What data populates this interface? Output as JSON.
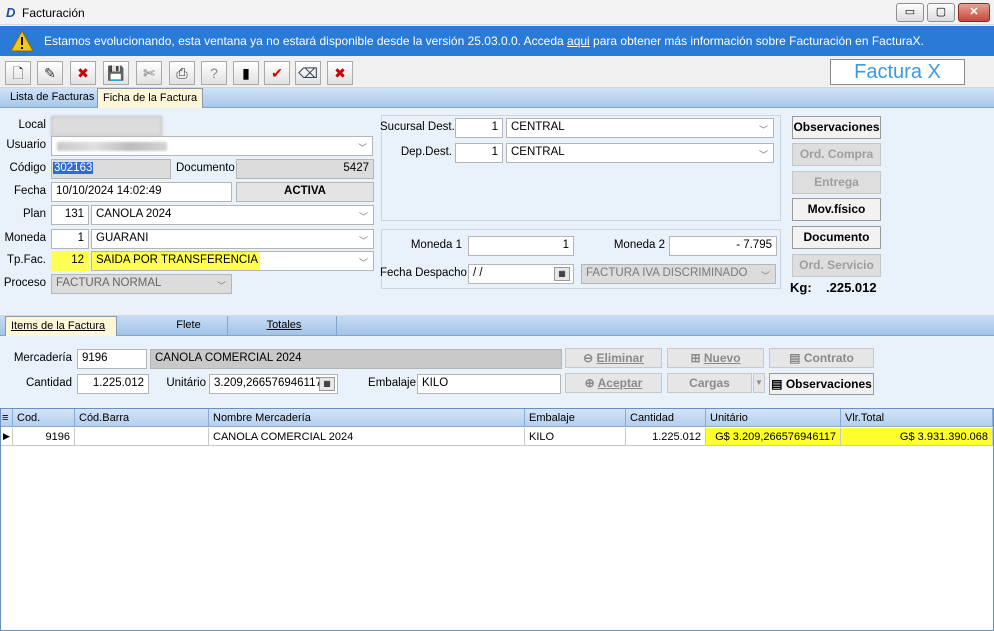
{
  "window": {
    "title": "Facturación",
    "minimize": "▭",
    "restore": "▢",
    "close": "✕"
  },
  "banner": {
    "pre": "Estamos evolucionando, esta ventana ya no estará disponible desde la versión 25.03.0.0. Acceda ",
    "link": "aqui",
    "post": " para obtener más información sobre Facturación en FacturaX."
  },
  "toolbar": {
    "icons": [
      "new-document-icon",
      "edit-document-icon",
      "delete-icon",
      "save-icon",
      "cut-icon",
      "print-icon",
      "help-icon",
      "exit-icon",
      "confirm-icon",
      "eraser-icon",
      "print-delete-icon"
    ],
    "glyphs": [
      "🗋",
      "✎",
      "✖",
      "💾",
      "✄",
      "⎙",
      "?",
      "▮",
      "✔",
      "⌫",
      "✖"
    ],
    "brand": "Factura X"
  },
  "main_tabs": [
    "Lista de Facturas",
    "Ficha de la Factura"
  ],
  "form": {
    "local_label": "Local",
    "usuario_label": "Usuario",
    "codigo_label": "Código",
    "codigo": "302163",
    "documento_label": "Documento",
    "documento": "5427",
    "fecha_label": "Fecha",
    "fecha": "10/10/2024 14:02:49",
    "estado": "ACTIVA",
    "plan_label": "Plan",
    "plan_code": "131",
    "plan": "CANOLA 2024",
    "moneda_label": "Moneda",
    "moneda_code": "1",
    "moneda": "GUARANI",
    "tpfac_label": "Tp.Fac.",
    "tpfac_code": "12",
    "tpfac": "SAIDA POR TRANSFERENCIA",
    "proceso_label": "Proceso",
    "proceso": "FACTURA NORMAL",
    "sucursal_label": "Sucursal Dest.",
    "sucursal_code": "1",
    "sucursal": "CENTRAL",
    "dep_label": "Dep.Dest.",
    "dep_code": "1",
    "dep": "CENTRAL",
    "moneda1_label": "Moneda 1",
    "moneda1": "1",
    "moneda2_label": "Moneda 2",
    "moneda2": "- 7.795",
    "despacho_label": "Fecha Despacho",
    "despacho": " /  /",
    "tipo_iva": "FACTURA IVA DISCRIMINADO",
    "kg_label": "Kg:",
    "kg": ".225.012"
  },
  "side_buttons": {
    "observaciones": "Observaciones",
    "ord_compra": "Ord. Compra",
    "entrega": "Entrega",
    "mov_fisico": "Mov.físico",
    "documento": "Documento",
    "ord_servicio": "Ord. Servicio"
  },
  "item_tabs": [
    "Items de la Factura",
    "Flete",
    "Totales"
  ],
  "item": {
    "mercaderia_label": "Mercadería",
    "mercaderia_code": "9196",
    "mercaderia": "CANOLA COMERCIAL 2024",
    "cantidad_label": "Cantidad",
    "cantidad": "1.225.012",
    "unitario_label": "Unitário",
    "unitario": "3.209,266576946117",
    "embalaje_label": "Embalaje",
    "embalaje": "KILO",
    "eliminar": "Eliminar",
    "nuevo": "Nuevo",
    "contrato": "Contrato",
    "aceptar": "Aceptar",
    "cargas": "Cargas",
    "observaciones": "Observaciones"
  },
  "grid": {
    "columns": [
      "Cod.",
      "Cód.Barra",
      "Nombre Mercadería",
      "Embalaje",
      "Cantidad",
      "Unitário",
      "Vlr.Total"
    ],
    "rows": [
      [
        "9196",
        "",
        "CANOLA COMERCIAL 2024",
        "KILO",
        "1.225.012",
        "G$ 3.209,266576946117",
        "G$ 3.931.390.068"
      ]
    ]
  }
}
